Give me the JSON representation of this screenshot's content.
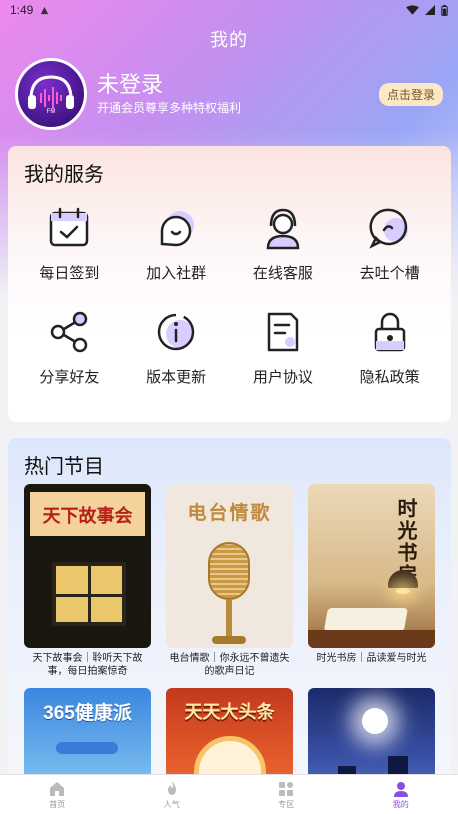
{
  "status_bar": {
    "time": "1:49"
  },
  "header": {
    "title": "我的"
  },
  "profile": {
    "name": "未登录",
    "subtitle": "开通会员尊享多种特权福利",
    "login_button": "点击登录",
    "avatar_text": "FM"
  },
  "services": {
    "title": "我的服务",
    "items": [
      {
        "label": "每日签到",
        "icon": "calendar-check-icon"
      },
      {
        "label": "加入社群",
        "icon": "chat-bubble-icon"
      },
      {
        "label": "在线客服",
        "icon": "headset-agent-icon"
      },
      {
        "label": "去吐个槽",
        "icon": "feedback-bubble-icon"
      },
      {
        "label": "分享好友",
        "icon": "share-icon"
      },
      {
        "label": "版本更新",
        "icon": "info-circle-icon"
      },
      {
        "label": "用户协议",
        "icon": "document-icon"
      },
      {
        "label": "隐私政策",
        "icon": "lock-icon"
      }
    ]
  },
  "programs": {
    "title": "热门节目",
    "items": [
      {
        "cover_title": "天下故事会",
        "caption": "天下故事会｜聆听天下故事，每日拍案惊奇"
      },
      {
        "cover_title": "电台情歌",
        "caption": "电台情歌｜你永远不曾遗失的歌声日记"
      },
      {
        "cover_title": "时光书房",
        "caption": "时光书房｜品读爱与时光"
      },
      {
        "cover_title": "365健康派",
        "caption": ""
      },
      {
        "cover_title": "天天大头条",
        "caption": ""
      },
      {
        "cover_title": "",
        "caption": ""
      }
    ]
  },
  "tabbar": {
    "tabs": [
      {
        "label": "首页",
        "icon": "home-icon",
        "active": false
      },
      {
        "label": "人气",
        "icon": "flame-icon",
        "active": false
      },
      {
        "label": "专区",
        "icon": "grid-icon",
        "active": false
      },
      {
        "label": "我的",
        "icon": "person-icon",
        "active": true
      }
    ]
  },
  "colors": {
    "accent": "#8a4fe0",
    "login_button_bg": "#fbe8c6"
  }
}
